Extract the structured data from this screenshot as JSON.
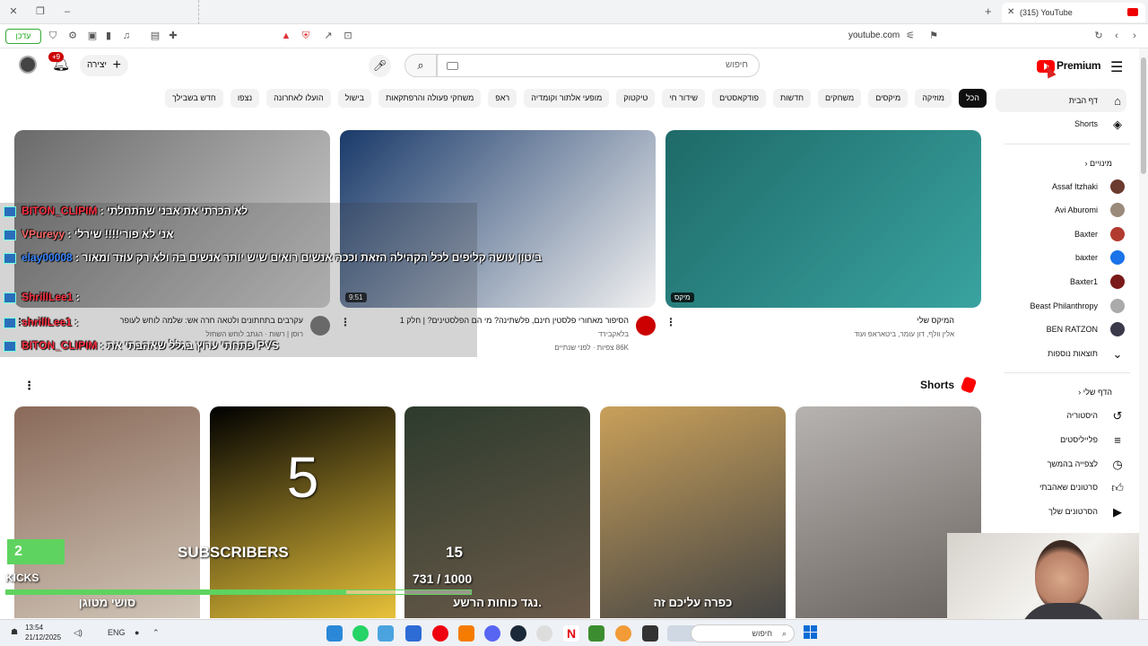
{
  "browser": {
    "tab_title": "(315) YouTube",
    "url": "youtube.com",
    "left_badge": "עדכן"
  },
  "masthead": {
    "logo_text": "Premium",
    "search_placeholder": "חיפוש",
    "create_label": "יצירה",
    "notifications_badge": "+9"
  },
  "chips": [
    "הכל",
    "מוזיקה",
    "מיקסים",
    "משחקים",
    "חדשות",
    "פודקאסטים",
    "שידור חי",
    "טיקטוק",
    "מופעי אלתור וקומדיה",
    "ראפ",
    "משחקי פעולה והרפתקאות",
    "בישול",
    "הועלו לאחרונה",
    "נצפו",
    "חדש בשבילך"
  ],
  "sidebar": {
    "home": "דף הבית",
    "shorts": "Shorts",
    "subscriptions_header": "מינויים",
    "channels": [
      {
        "name": "Assaf Itzhaki",
        "color": "#6b3b2f"
      },
      {
        "name": "Avi Aburomi",
        "color": "#9a8a7a"
      },
      {
        "name": "Baxter",
        "color": "#b23b2f"
      },
      {
        "name": "baxter",
        "color": "#1a73e8"
      },
      {
        "name": "Baxter1",
        "color": "#7a1a1a"
      },
      {
        "name": "Beast Philanthropy",
        "color": "#aaaaaa"
      },
      {
        "name": "BEN RATZON",
        "color": "#3a3a4a"
      }
    ],
    "more_results": "תוצאות נוספות",
    "you_header": "הדף שלי",
    "you_items": [
      "היסטוריה",
      "פלייליסטים",
      "לצפייה בהמשך",
      "סרטונים שאהבתי",
      "הסרטונים שלך"
    ]
  },
  "videos": [
    {
      "title": "המיקס שלי",
      "meta": "אלין וולף, דון עומר, ביטאראפ ועוד",
      "meta2": "",
      "duration": "מיקס",
      "thumb_colors": [
        "#1e6a68",
        "#39a3a0"
      ]
    },
    {
      "title": "הסיפור מאחורי פלסטין חינם, פלשתינה? מי הם הפלסטינים? | חלק 1",
      "meta": "בלאקבירד",
      "meta2": "86K צפיות · לפני שנתיים",
      "duration": "9:51",
      "thumb_colors": [
        "#1a3a6a",
        "#f1f1f1"
      ]
    },
    {
      "title": "עקרבים בתחתונים ולטאה חרה אש: שלמה לוחש לעופר",
      "meta": "רוסן | רשות · הגתב לוחש השחזל",
      "meta2": "",
      "duration": "",
      "thumb_colors": [
        "#6a6a6a",
        "#cfcfcf"
      ]
    }
  ],
  "shorts": {
    "header": "Shorts",
    "items": [
      {
        "caption": "כפרה עליכם זה",
        "colors": [
          "#c9a05a",
          "#444"
        ]
      },
      {
        "caption": "",
        "colors": [
          "#b7b3b0",
          "#6a6460"
        ]
      },
      {
        "caption": "נגד כוחות הרשע.",
        "colors": [
          "#2d3b2d",
          "#6b5a4a"
        ]
      },
      {
        "caption": "5",
        "colors": [
          "#000000",
          "#e8c23a"
        ]
      },
      {
        "caption": "סושי מטוגן",
        "colors": [
          "#8a6a5a",
          "#d1c6b8"
        ]
      }
    ]
  },
  "chat": [
    {
      "user": "BITON_CLIPIM",
      "text": "לא הכרתי את אבני שהתחלתי",
      "color": "#ff3344"
    },
    {
      "user": "VPureyy",
      "text": "אני לא פורי!!!! שירלי",
      "color": "#ff6a6a"
    },
    {
      "user": "elay00008",
      "text": "ביטון עושה קליפים לכל הקהילה הזאת וככה אנשים רואים שיש יותר אנשים בה ולא רק עוזד ומאור",
      "color": "#3a86ff"
    },
    {
      "user": "ShrillLee1",
      "text": "",
      "color": "#ff3344"
    },
    {
      "user": "shrillLee1",
      "text": "",
      "color": "#ff3344"
    },
    {
      "user": "BITON_CLIPIM",
      "text": "פתחתי ערוץ בגלל שאהבתי את PVS",
      "color": "#ff3344"
    }
  ],
  "overlay": {
    "subs_now": "2",
    "subs_label": "SUBSCRIBERS",
    "subs_goal": "15",
    "kicks_label": "KICKS",
    "kicks_value": "731 / 1000",
    "kicks_progress": 0.731
  },
  "taskbar": {
    "time": "13:54",
    "date": "21/12/2025",
    "lang": "ENG",
    "search_label": "חיפוש"
  }
}
